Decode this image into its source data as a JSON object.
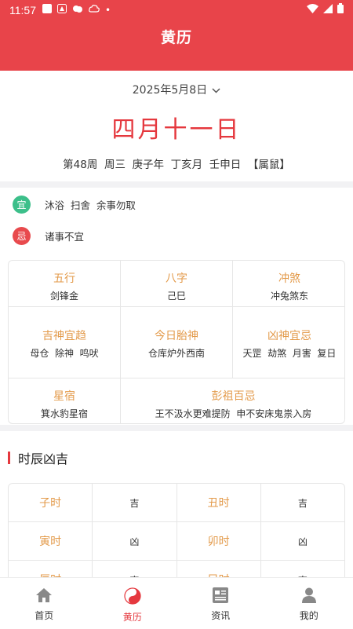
{
  "status_bar": {
    "time": "11:57",
    "dot": "•"
  },
  "header": {
    "title": "黄历"
  },
  "date_card": {
    "selected_date": "2025年5月8日",
    "lunar_date": "四月十一日",
    "week": "第48周",
    "weekday": "周三",
    "year_gz": "庚子年",
    "month_gz": "丁亥月",
    "day_gz": "壬申日",
    "zodiac": "【属鼠】"
  },
  "yi": {
    "badge": "宜",
    "text": "沐浴  扫舍  余事勿取"
  },
  "ji": {
    "badge": "忌",
    "text": "诸事不宜"
  },
  "info": {
    "wuxing": {
      "label": "五行",
      "value": "剑锋金"
    },
    "bazi": {
      "label": "八字",
      "value": "己巳"
    },
    "chongsha": {
      "label": "冲煞",
      "value": "冲兔煞东"
    },
    "jishen": {
      "label": "吉神宜趋",
      "value": "母仓  除神  鸣吠"
    },
    "taishen": {
      "label": "今日胎神",
      "value": "仓库炉外西南"
    },
    "xiongshen": {
      "label": "凶神宜忌",
      "value": "天罡  劫煞  月害  复日"
    },
    "xingsu": {
      "label": "星宿",
      "value": "箕水豹星宿"
    },
    "pengzu": {
      "label": "彭祖百忌",
      "value": "王不汲水更难提防  申不安床鬼祟入房"
    }
  },
  "hours": {
    "title": "时辰凶吉",
    "rows": [
      {
        "a_name": "子时",
        "a_val": "吉",
        "b_name": "丑时",
        "b_val": "吉"
      },
      {
        "a_name": "寅时",
        "a_val": "凶",
        "b_name": "卯时",
        "b_val": "凶"
      },
      {
        "a_name": "辰时",
        "a_val": "吉",
        "b_name": "巳时",
        "b_val": "吉"
      }
    ]
  },
  "tabs": [
    {
      "label": "首页",
      "icon": "home-icon"
    },
    {
      "label": "黄历",
      "icon": "yin-yang-icon",
      "active": true
    },
    {
      "label": "资讯",
      "icon": "news-icon"
    },
    {
      "label": "我的",
      "icon": "person-icon"
    }
  ],
  "colors": {
    "brand": "#e8444a",
    "accent_orange": "#e39a4a",
    "yi_green": "#3cbf8a",
    "ji_red": "#e84a4d"
  }
}
